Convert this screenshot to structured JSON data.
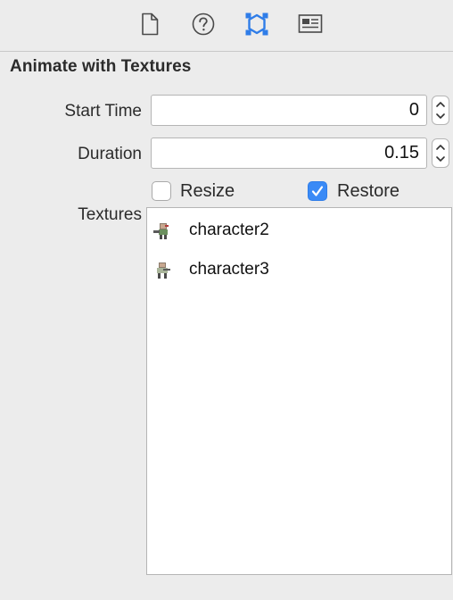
{
  "toolbar": {
    "tabs": [
      {
        "icon": "file-icon",
        "selected": false
      },
      {
        "icon": "help-icon",
        "selected": false
      },
      {
        "icon": "attributes-inspector-icon",
        "selected": true
      },
      {
        "icon": "library-icon",
        "selected": false
      }
    ],
    "accent_color": "#2f7de8"
  },
  "section": {
    "title": "Animate with Textures"
  },
  "start_time": {
    "label": "Start Time",
    "value": "0"
  },
  "duration": {
    "label": "Duration",
    "value": "0.15"
  },
  "options": {
    "resize": {
      "label": "Resize",
      "checked": false
    },
    "restore": {
      "label": "Restore",
      "checked": true
    }
  },
  "textures": {
    "label": "Textures",
    "items": [
      {
        "name": "character2"
      },
      {
        "name": "character3"
      }
    ]
  }
}
